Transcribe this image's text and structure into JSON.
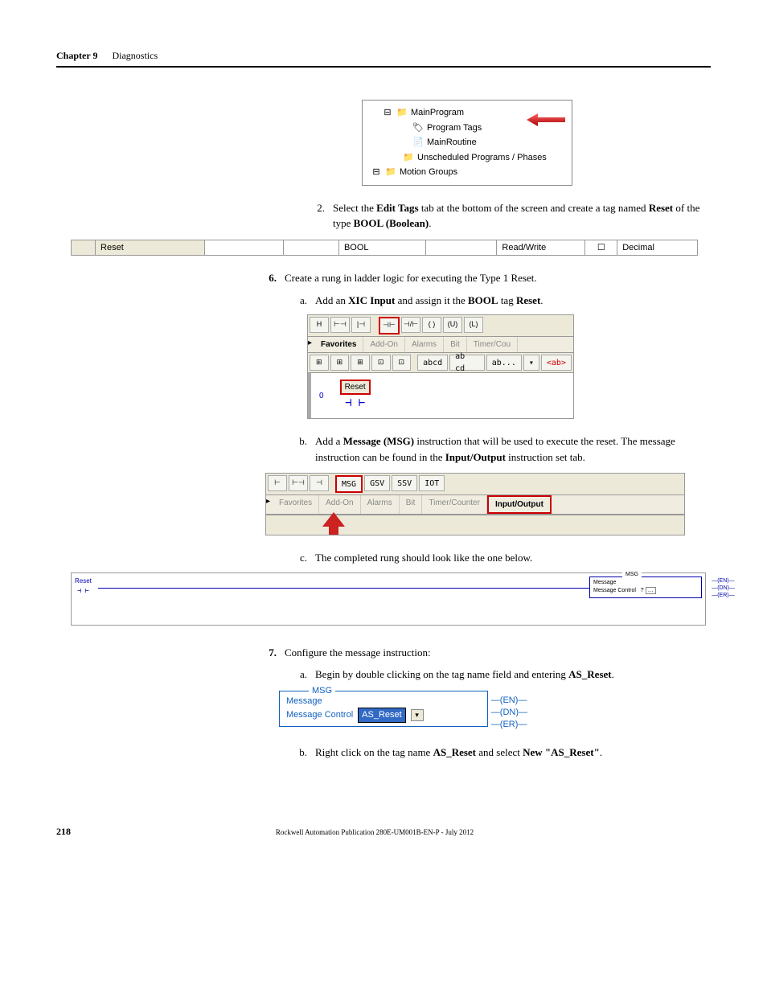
{
  "header": {
    "chapter": "Chapter 9",
    "title": "Diagnostics"
  },
  "tree": {
    "main_program": "MainProgram",
    "program_tags": "Program Tags",
    "main_routine": "MainRoutine",
    "unscheduled": "Unscheduled Programs / Phases",
    "motion_groups": "Motion Groups"
  },
  "step2": {
    "num": "2.",
    "pre": "Select the ",
    "edit_tags": "Edit Tags",
    "mid": " tab at the bottom of the screen and create a tag named ",
    "reset": "Reset",
    "mid2": " of the type ",
    "bool": "BOOL (Boolean)",
    "end": "."
  },
  "tag_row": {
    "name": "Reset",
    "type": "BOOL",
    "access": "Read/Write",
    "style": "Decimal"
  },
  "step6": {
    "num": "6.",
    "text": "Create a rung in ladder logic for executing the Type 1 Reset."
  },
  "step6a": {
    "marker": "a.",
    "pre": "Add an ",
    "xic": "XIC Input",
    "mid": " and assign it the ",
    "bool": "BOOL",
    "mid2": " tag ",
    "reset": "Reset",
    "end": "."
  },
  "ladder1": {
    "toolbar_labels": [
      "H",
      "⊢⊣",
      "|⊣",
      "⊣⊢",
      "⊣/⊢",
      "( )",
      "(U)",
      "(L)"
    ],
    "tabs": [
      "Favorites",
      "Add-On",
      "Alarms",
      "Bit",
      "Timer/Cou"
    ],
    "toolbar2": [
      "⊞",
      "⊞",
      "⊞",
      "⊡",
      "⊡",
      "abcd",
      "ab cd",
      "ab...",
      "▾",
      "<ab>"
    ],
    "rung_num": "0",
    "xic_label": "Reset"
  },
  "step6b": {
    "marker": "b.",
    "pre": "Add a ",
    "msg": "Message (MSG)",
    "mid": " instruction that will be used to execute the reset. The message instruction can be found in the ",
    "io": "Input/Output",
    "end": " instruction set tab."
  },
  "ladder2": {
    "toolbar_labels": [
      "⊢",
      "⊢⊣",
      "⊣",
      "MSG",
      "GSV",
      "SSV",
      "IOT"
    ],
    "tabs": [
      "Favorites",
      "Add-On",
      "Alarms",
      "Bit",
      "Timer/Counter",
      "Input/Output"
    ]
  },
  "step6c": {
    "marker": "c.",
    "text": "The completed rung should look like the one below."
  },
  "complete_rung": {
    "reset": "Reset",
    "msg_title": "MSG",
    "msg_line1": "Message",
    "msg_line2": "Message Control",
    "q": "?",
    "en": "(EN)",
    "dn": "(DN)",
    "er": "(ER)"
  },
  "step7": {
    "num": "7.",
    "text": "Configure the message instruction:"
  },
  "step7a": {
    "marker": "a.",
    "pre": "Begin by double clicking on the tag name field and entering ",
    "tag": "AS_Reset",
    "end": "."
  },
  "msg_config": {
    "title": "MSG",
    "line1": "Message",
    "line2": "Message Control",
    "dropdown": "AS_Reset",
    "en": "(EN)",
    "dn": "(DN)",
    "er": "(ER)"
  },
  "step7b": {
    "marker": "b.",
    "pre": "Right click on the tag name ",
    "tag": "AS_Reset",
    "mid": " and select ",
    "new": "New \"AS_Reset\"",
    "end": "."
  },
  "footer": {
    "page": "218",
    "pub": "Rockwell Automation Publication 280E-UM001B-EN-P - July 2012"
  }
}
